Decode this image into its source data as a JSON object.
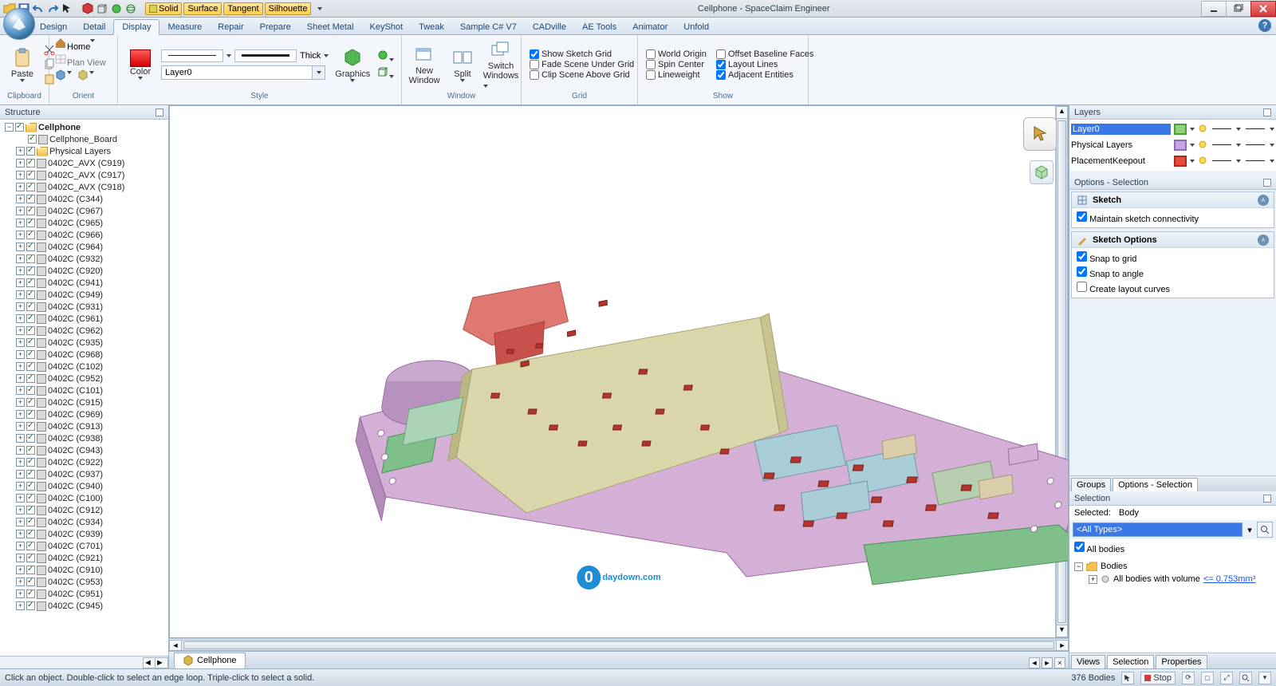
{
  "app": {
    "title": "Cellphone - SpaceClaim Engineer"
  },
  "qat_chips": [
    "Solid",
    "Surface",
    "Tangent",
    "Silhouette"
  ],
  "tabs": [
    "Design",
    "Detail",
    "Display",
    "Measure",
    "Repair",
    "Prepare",
    "Sheet Metal",
    "KeyShot",
    "Tweak",
    "Sample C# V7",
    "CADville",
    "AE Tools",
    "Animator",
    "Unfold"
  ],
  "active_tab": "Display",
  "ribbon": {
    "clipboard": {
      "label": "Clipboard",
      "paste": "Paste"
    },
    "orient": {
      "label": "Orient",
      "home": "Home",
      "planview": "Plan View"
    },
    "style": {
      "label": "Style",
      "color": "Color",
      "layer": "Layer0",
      "thick": "Thick",
      "graphics": "Graphics"
    },
    "window": {
      "label": "Window",
      "newwindow_l1": "New",
      "newwindow_l2": "Window",
      "split": "Split",
      "switch_l1": "Switch",
      "switch_l2": "Windows"
    },
    "grid": {
      "label": "Grid",
      "c1": "Show Sketch Grid",
      "c2": "Fade Scene Under Grid",
      "c3": "Clip Scene Above Grid"
    },
    "show": {
      "label": "Show",
      "a1": "World Origin",
      "a2": "Spin Center",
      "a3": "Lineweight",
      "b1": "Offset Baseline Faces",
      "b2": "Layout Lines",
      "b3": "Adjacent Entities"
    }
  },
  "structure": {
    "title": "Structure",
    "root": "Cellphone",
    "children_top": [
      "Cellphone_Board",
      "Physical Layers"
    ],
    "items": [
      "0402C_AVX (C919)",
      "0402C_AVX (C917)",
      "0402C_AVX (C918)",
      "0402C (C344)",
      "0402C (C967)",
      "0402C (C965)",
      "0402C (C966)",
      "0402C (C964)",
      "0402C (C932)",
      "0402C (C920)",
      "0402C (C941)",
      "0402C (C949)",
      "0402C (C931)",
      "0402C (C961)",
      "0402C (C962)",
      "0402C (C935)",
      "0402C (C968)",
      "0402C (C102)",
      "0402C (C952)",
      "0402C (C101)",
      "0402C (C915)",
      "0402C (C969)",
      "0402C (C913)",
      "0402C (C938)",
      "0402C (C943)",
      "0402C (C922)",
      "0402C (C937)",
      "0402C (C940)",
      "0402C (C100)",
      "0402C (C912)",
      "0402C (C934)",
      "0402C (C939)",
      "0402C (C701)",
      "0402C (C921)",
      "0402C (C910)",
      "0402C (C953)",
      "0402C (C951)",
      "0402C (C945)"
    ]
  },
  "doc_tab": "Cellphone",
  "layers": {
    "title": "Layers",
    "rows": [
      {
        "name": "Layer0",
        "color": "#8fd47a",
        "border": "#4d9a39"
      },
      {
        "name": "Physical Layers",
        "color": "#c7a6e6",
        "border": "#8b6db3"
      },
      {
        "name": "PlacementKeepout",
        "color": "#e74a3a",
        "border": "#a52e22"
      }
    ]
  },
  "options": {
    "title": "Options - Selection",
    "sketch_head": "Sketch",
    "sketch_c1": "Maintain sketch connectivity",
    "sketchopt_head": "Sketch Options",
    "so1": "Snap to grid",
    "so2": "Snap to angle",
    "so3": "Create layout curves"
  },
  "right_tabs": {
    "groups": "Groups",
    "options": "Options - Selection"
  },
  "selection": {
    "title": "Selection",
    "selected_label": "Selected:",
    "selected_value": "Body",
    "filter_value": "<All Types>",
    "allbodies": "All bodies",
    "bodies_folder": "Bodies",
    "bodies_rule_pre": "All bodies with volume ",
    "bodies_rule_link": "<= 0.753mm³"
  },
  "bottom_tabs": [
    "Views",
    "Selection",
    "Properties"
  ],
  "status": {
    "hint": "Click an object. Double-click to select an edge loop. Triple-click to select a solid.",
    "bodies": "376 Bodies",
    "stop": "Stop"
  },
  "watermark": "daydown.com"
}
